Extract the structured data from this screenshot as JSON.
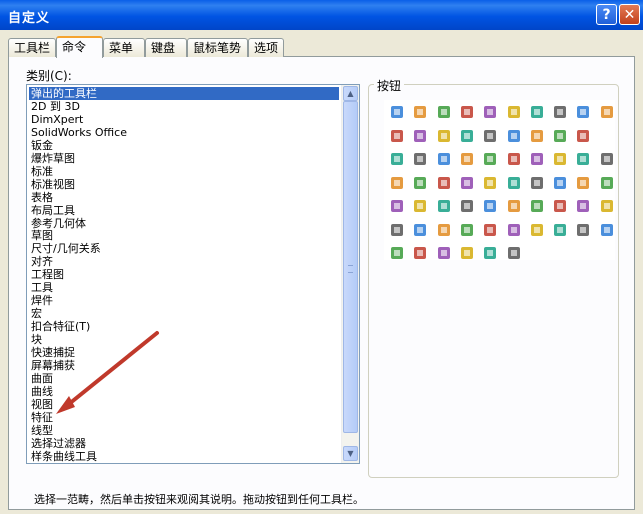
{
  "window": {
    "title": "自定义",
    "help_label": "?",
    "close_label": "✕"
  },
  "tabs": [
    "工具栏",
    "命令",
    "菜单",
    "键盘",
    "鼠标笔势",
    "选项"
  ],
  "active_tab": "命令",
  "category_label": "类别(C):",
  "categories": [
    "弹出的工具栏",
    "2D 到 3D",
    "DimXpert",
    "SolidWorks Office",
    "钣金",
    "爆炸草图",
    "标准",
    "标准视图",
    "表格",
    "布局工具",
    "参考几何体",
    "草图",
    "尺寸/几何关系",
    "对齐",
    "工程图",
    "工具",
    "焊件",
    "宏",
    "扣合特征(T)",
    "块",
    "快速捕捉",
    "屏幕捕获",
    "曲面",
    "曲线",
    "视图",
    "特征",
    "线型",
    "选择过滤器",
    "样条曲线工具"
  ],
  "selected_category": "弹出的工具栏",
  "buttons_label": "按钮",
  "description": "选择一范畴，然后单击按钮来观阅其说明。拖动按钮到任何工具栏。",
  "colors": {
    "title_bar": "#0054e3",
    "selection": "#316ac5",
    "arrow": "#c0392b",
    "tab_highlight": "#f5a32f"
  },
  "button_icons": [
    [
      "table-icon",
      "dimension-icon",
      "font-icon",
      "box-icon",
      "text-box-icon",
      "curve-icon",
      "relation-icon",
      "target-icon",
      "grid-icon",
      "stairs-icon"
    ],
    [
      "gear-icon",
      "bold-text-icon",
      "lines-icon",
      "block-icon",
      "cube-view-icon",
      "point-icon",
      "sparkle-icon",
      "grid-select-icon",
      "filter-icon"
    ],
    [
      "settings-icon",
      "pencil-icon",
      "cube-red-icon",
      "mirror-icon",
      "disk-icon",
      "stack-icon",
      "tag-icon",
      "table-grid-icon",
      "camera-icon",
      "box-open-icon"
    ],
    [
      "globe-icon",
      "chart-icon",
      "new-doc-icon",
      "folder-icon",
      "save-icon",
      "print-icon",
      "list-icon",
      "edit-icon",
      "line-icon",
      "rectangle-icon"
    ],
    [
      "link-icon",
      "circle-icon",
      "arc-icon",
      "ellipse-icon",
      "spline-icon",
      "corner-icon",
      "frame-icon",
      "square-icon",
      "matrix-icon",
      "dots-grid-icon"
    ],
    [
      "plug-icon",
      "ruler-icon",
      "cube-gold-icon",
      "cylinder-icon",
      "shape-green-icon",
      "pattern-icon",
      "palette-icon",
      "arrow-right-icon",
      "pin-icon",
      "hole-icon"
    ],
    [
      "stamp-icon",
      "rotate-icon",
      "sphere-gold-icon",
      "wizard-icon",
      "tool-icon",
      "spiral-icon"
    ]
  ]
}
